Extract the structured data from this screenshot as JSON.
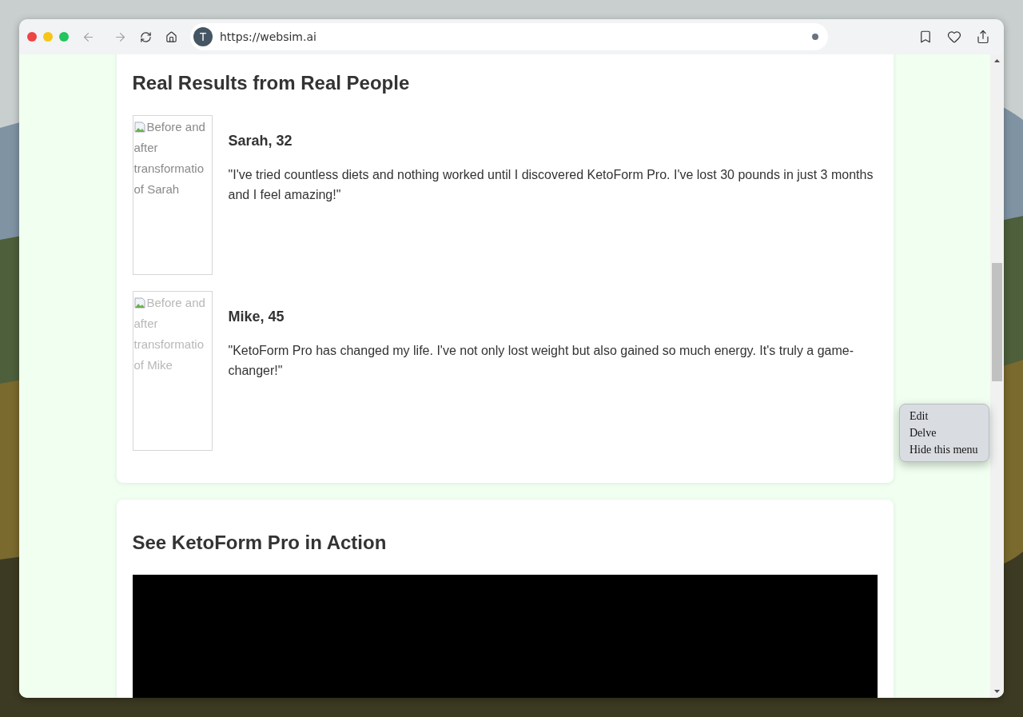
{
  "browser": {
    "avatar_letter": "T",
    "url": "https://websim.ai"
  },
  "sections": [
    {
      "kind": "testimonials",
      "heading": "Real Results from Real People",
      "testimonials": [
        {
          "image_alt": "Before and after transformatio of Sarah",
          "name": "Sarah, 32",
          "quote": "\"I've tried countless diets and nothing worked until I discovered KetoForm Pro. I've lost 30 pounds in just 3 months and I feel amazing!\""
        },
        {
          "image_alt": "Before and after transformatio of Mike",
          "name": "Mike, 45",
          "quote": "\"KetoForm Pro has changed my life. I've not only lost weight but also gained so much energy. It's truly a game-changer!\""
        }
      ]
    },
    {
      "kind": "video",
      "heading": "See KetoForm Pro in Action"
    }
  ],
  "context_menu": {
    "items": [
      "Edit",
      "Delve",
      "Hide this menu"
    ]
  }
}
